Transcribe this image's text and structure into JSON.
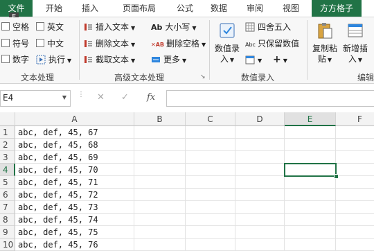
{
  "tabs": {
    "file": "文件",
    "home": "开始",
    "insert": "插入",
    "page_layout": "页面布局",
    "formulas": "公式",
    "data": "数据",
    "review": "审阅",
    "view": "视图",
    "addin": "方方格子"
  },
  "keytip": "F",
  "ribbon": {
    "text_processing": {
      "checkboxes": [
        "空格",
        "英文",
        "符号",
        "中文",
        "数字"
      ],
      "execute": "执行",
      "group_label": "文本处理"
    },
    "advanced_text": {
      "insert_text": "插入文本",
      "delete_text": "删除文本",
      "extract_text": "截取文本",
      "case": "大小写",
      "delete_spaces": "删除空格",
      "more": "更多",
      "group_label": "高级文本处理"
    },
    "value_entry": {
      "value_entry_line1": "数值录",
      "value_entry_line2": "入",
      "round": "四舍五入",
      "keep_values": "只保留数值",
      "plus": "+",
      "group_label": "数值录入"
    },
    "copy_paste_line1": "复制粘",
    "copy_paste_line2": "贴",
    "add_insert_line1": "新增插",
    "add_insert_line2": "入",
    "edit_label": "编辑"
  },
  "formula_bar": {
    "name_box": "E4",
    "cancel": "✕",
    "confirm": "✓",
    "fx": "fx",
    "content": ""
  },
  "sheet": {
    "columns": [
      "A",
      "B",
      "C",
      "D",
      "E",
      "F"
    ],
    "selected_column": "E",
    "selected_row": "4",
    "rows": [
      {
        "n": "1",
        "a": "abc, def, 45, 67"
      },
      {
        "n": "2",
        "a": "abc, def, 45, 68"
      },
      {
        "n": "3",
        "a": "abc, def, 45, 69"
      },
      {
        "n": "4",
        "a": "abc, def, 45, 70"
      },
      {
        "n": "5",
        "a": "abc, def, 45, 71"
      },
      {
        "n": "6",
        "a": "abc, def, 45, 72"
      },
      {
        "n": "7",
        "a": "abc, def, 45, 73"
      },
      {
        "n": "8",
        "a": "abc, def, 45, 74"
      },
      {
        "n": "9",
        "a": "abc, def, 45, 75"
      },
      {
        "n": "10",
        "a": "abc, def, 45, 76"
      }
    ]
  },
  "colors": {
    "accent": "#217346",
    "ribbon_bg": "#f7f7f7",
    "header_bg": "#f3f3f3"
  }
}
